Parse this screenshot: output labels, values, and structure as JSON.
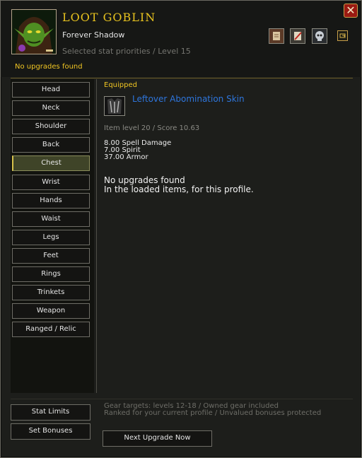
{
  "window": {
    "title": "LOOT GOBLIN",
    "subtitle": "Forever Shadow",
    "priorities": "Selected stat priorities / Level 15",
    "status": "No upgrades found",
    "close_glyph": "✕"
  },
  "toolbar": {
    "icons": [
      "paper-icon",
      "scroll-icon",
      "skull-icon",
      "settings-icon"
    ]
  },
  "slots": [
    {
      "label": "Head"
    },
    {
      "label": "Neck"
    },
    {
      "label": "Shoulder"
    },
    {
      "label": "Back"
    },
    {
      "label": "Chest"
    },
    {
      "label": "Wrist"
    },
    {
      "label": "Hands"
    },
    {
      "label": "Waist"
    },
    {
      "label": "Legs"
    },
    {
      "label": "Feet"
    },
    {
      "label": "Rings"
    },
    {
      "label": "Trinkets"
    },
    {
      "label": "Weapon"
    },
    {
      "label": "Ranged / Relic"
    }
  ],
  "selected_slot": "Chest",
  "equipped": {
    "label": "Equipped",
    "name": "Leftover Abomination Skin",
    "score_line": "Item level 20 / Score 10.63",
    "stats": [
      "8.00 Spell Damage",
      "7.00 Spirit",
      "37.00 Armor"
    ]
  },
  "messages": {
    "line1": "No upgrades found",
    "line2": "In the loaded items, for this profile."
  },
  "footer": {
    "stat_limits": "Stat Limits",
    "set_bonuses": "Set Bonuses",
    "next_upgrade": "Next Upgrade Now",
    "note1": "Gear targets: levels 12-18 / Owned gear included",
    "note2": "Ranked for your current profile / Unvalued bonuses protected"
  },
  "colors": {
    "gold": "#f0c523",
    "link_blue": "#2e76dd",
    "panel": "#1d1e1b"
  }
}
